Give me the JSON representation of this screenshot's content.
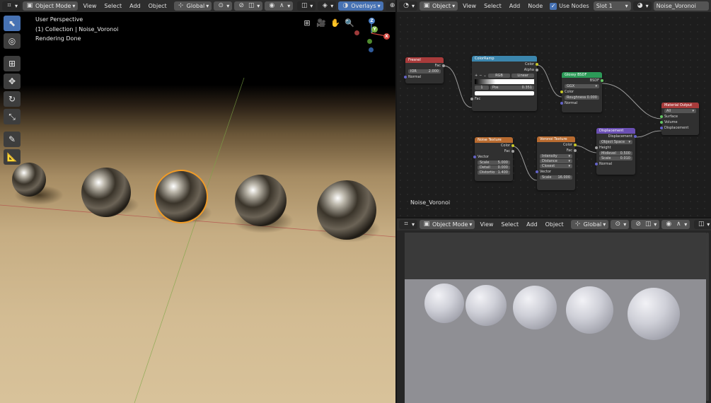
{
  "viewport": {
    "mode": "Object Mode",
    "menus": [
      "View",
      "Select",
      "Add",
      "Object"
    ],
    "orientation": "Global",
    "overlays": "Overlays",
    "overlay_lines": [
      "User Perspective",
      "(1) Collection | Noise_Voronoi",
      "Rendering Done"
    ],
    "gizmo": {
      "z": "Z",
      "y": "Y",
      "x": "X"
    }
  },
  "node_editor": {
    "type": "Object",
    "menus": [
      "View",
      "Select",
      "Add",
      "Node"
    ],
    "use_nodes_label": "Use Nodes",
    "use_nodes": true,
    "slot": "Slot 1",
    "material": "Noise_Voronoi",
    "material_label": "Noise_Voronoi",
    "nodes": {
      "fresnel": {
        "title": "Fresnel",
        "fac": "Fac",
        "ior_label": "IOR",
        "ior": "2.000",
        "normal": "Normal"
      },
      "colorramp": {
        "title": "ColorRamp",
        "color": "Color",
        "alpha": "Alpha",
        "mode": "RGB",
        "interp": "Linear",
        "index": "1",
        "pos_label": "Pos",
        "pos": "0.351",
        "fac": "Fac"
      },
      "glossy": {
        "title": "Glossy BSDF",
        "bsdf": "BSDF",
        "dist": "GGX",
        "color": "Color",
        "rough_label": "Roughness",
        "rough": "0.000",
        "normal": "Normal"
      },
      "output": {
        "title": "Material Output",
        "target": "All",
        "surface": "Surface",
        "volume": "Volume",
        "displacement": "Displacement"
      },
      "noise": {
        "title": "Noise Texture",
        "color": "Color",
        "fac": "Fac",
        "vector": "Vector",
        "scale_label": "Scale",
        "scale": "5.000",
        "detail_label": "Detail",
        "detail": "0.000",
        "distortion_label": "Distortio",
        "distortion": "1.400"
      },
      "voronoi": {
        "title": "Voronoi Texture",
        "color": "Color",
        "fac": "Fac",
        "coloring": "Intensity",
        "metric": "Distance",
        "feature": "Closest",
        "vector": "Vector",
        "scale_label": "Scale",
        "scale": "16.000"
      },
      "displacement": {
        "title": "Displacement",
        "out": "Displacement",
        "space": "Object Space",
        "height": "Height",
        "mid_label": "Midlevel",
        "mid": "0.500",
        "scale_label": "Scale",
        "scale": "0.010",
        "normal": "Normal"
      }
    }
  },
  "preview": {
    "mode": "Object Mode",
    "menus": [
      "View",
      "Select",
      "Add",
      "Object"
    ],
    "orientation": "Global"
  },
  "colors": {
    "accent": "#4772b3",
    "fresnel_header": "#a83b3b",
    "colorramp_header": "#3b86ad",
    "glossy_header": "#2c9a58",
    "output_header": "#a83b3b",
    "noise_header": "#b86b30",
    "voronoi_header": "#b86b30",
    "displacement_header": "#6a4fb3"
  }
}
